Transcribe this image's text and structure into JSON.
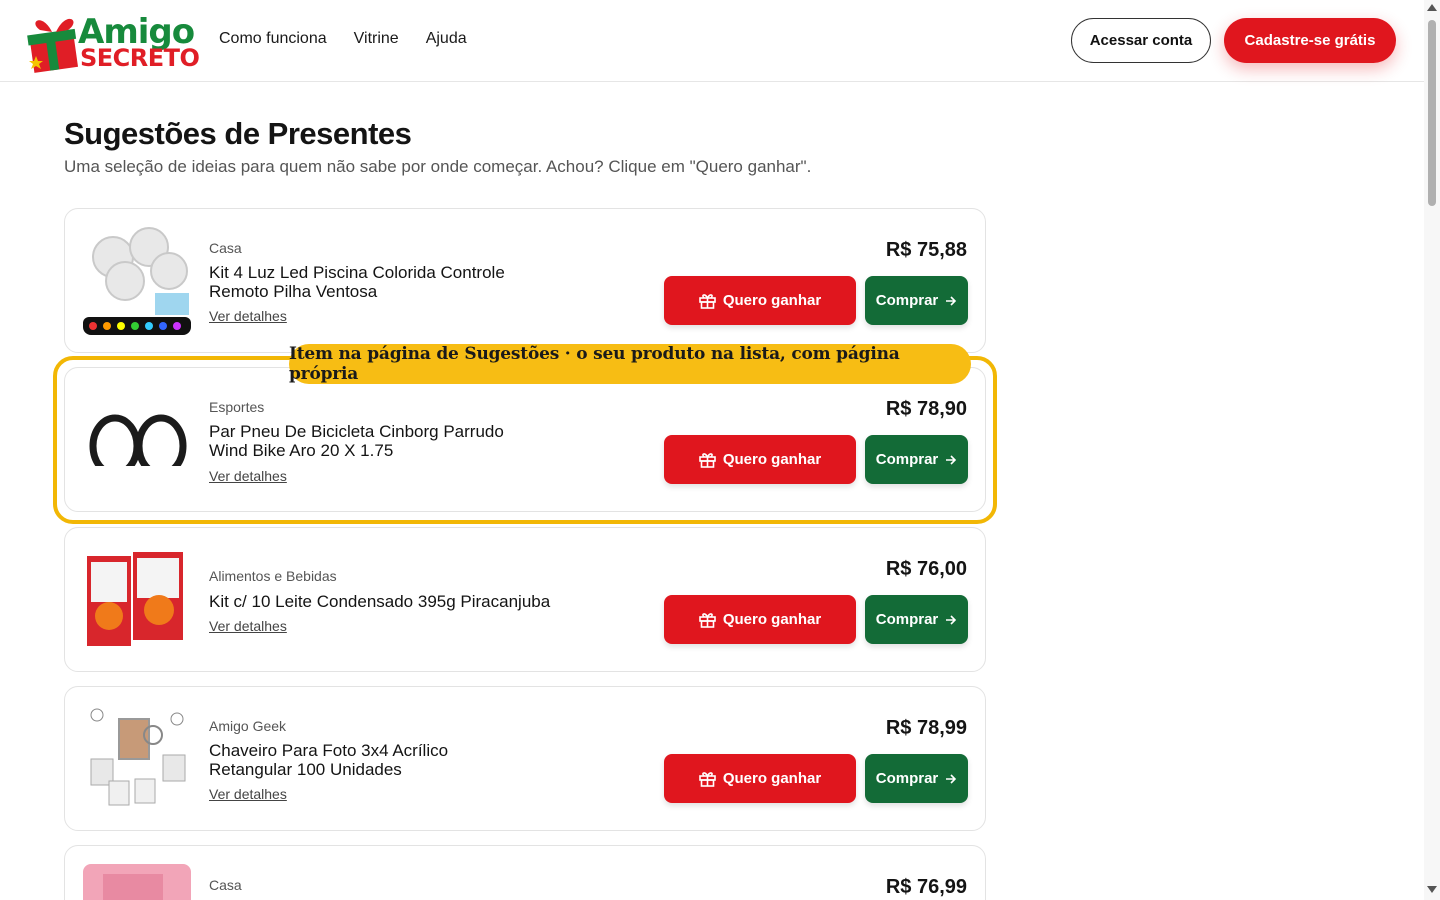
{
  "header": {
    "logo_top": "Amigo",
    "logo_bottom": "SECRETO",
    "nav": [
      "Como funciona",
      "Vitrine",
      "Ajuda"
    ],
    "login_label": "Acessar conta",
    "signup_label": "Cadastre-se grátis"
  },
  "page": {
    "title": "Sugestões de Presentes",
    "subtitle": "Uma seleção de ideias para quem não sabe por onde começar. Achou? Clique em \"Quero ganhar\"."
  },
  "callout": "Item na página de Sugestões · o seu produto na lista, com página própria",
  "buttons": {
    "want": "Quero ganhar",
    "buy": "Comprar",
    "details": "Ver detalhes"
  },
  "products": [
    {
      "category": "Casa",
      "name": "Kit 4 Luz Led Piscina Colorida Controle Remoto Pilha Ventosa",
      "price": "R$ 75,88",
      "image": "pool-led-lights"
    },
    {
      "category": "Esportes",
      "name": "Par Pneu De Bicicleta Cinborg Parrudo Wind Bike Aro 20 X 1.75",
      "price": "R$ 78,90",
      "image": "bicycle-tires"
    },
    {
      "category": "Alimentos e Bebidas",
      "name": "Kit c/ 10 Leite Condensado 395g Piracanjuba",
      "price": "R$ 76,00",
      "image": "condensed-milk-boxes"
    },
    {
      "category": "Amigo Geek",
      "name": "Chaveiro Para Foto 3x4 Acrílico Retangular 100 Unidades",
      "price": "R$ 78,99",
      "image": "photo-keychains"
    },
    {
      "category": "Casa",
      "name": "",
      "price": "R$ 76,99",
      "image": "pink-product"
    }
  ],
  "colors": {
    "brand_red": "#e0161e",
    "brand_green": "#136b37",
    "highlight_yellow": "#f2b705"
  }
}
